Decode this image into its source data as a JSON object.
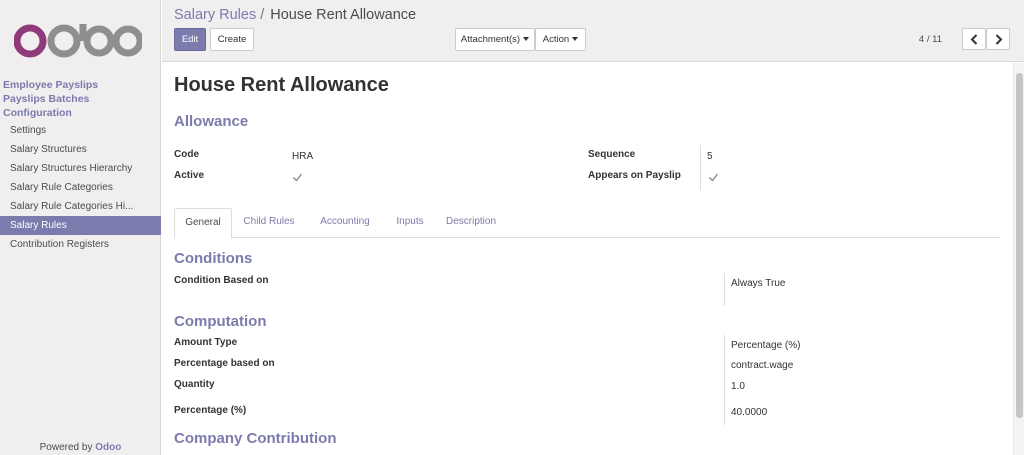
{
  "brand": {
    "logo_text": "odoo",
    "accent": "#7c7bad",
    "logo_color_o": "#8f3b7a",
    "logo_color_rest": "#8f8f8f"
  },
  "sidebar": {
    "headings": [
      "Employee Payslips",
      "Payslips Batches",
      "Configuration"
    ],
    "items": [
      {
        "label": "Settings",
        "active": false
      },
      {
        "label": "Salary Structures",
        "active": false
      },
      {
        "label": "Salary Structures Hierarchy",
        "active": false
      },
      {
        "label": "Salary Rule Categories",
        "active": false
      },
      {
        "label": "Salary Rule Categories Hi...",
        "active": false
      },
      {
        "label": "Salary Rules",
        "active": true
      },
      {
        "label": "Contribution Registers",
        "active": false
      }
    ],
    "powered_prefix": "Powered by",
    "powered_brand": "Odoo"
  },
  "breadcrumb": {
    "parent": "Salary Rules",
    "separator": "/",
    "current": "House Rent Allowance"
  },
  "toolbar": {
    "edit_label": "Edit",
    "create_label": "Create",
    "attachments_label": "Attachment(s)",
    "action_label": "Action",
    "pager": "4 / 11"
  },
  "form": {
    "title": "House Rent Allowance",
    "category": "Allowance",
    "fields": {
      "code_label": "Code",
      "code_value": "HRA",
      "sequence_label": "Sequence",
      "sequence_value": "5",
      "active_label": "Active",
      "active_checked": true,
      "payslip_label": "Appears on Payslip",
      "payslip_checked": true
    },
    "tabs": [
      {
        "label": "General",
        "active": true
      },
      {
        "label": "Child Rules",
        "active": false
      },
      {
        "label": "Accounting",
        "active": false
      },
      {
        "label": "Inputs",
        "active": false
      },
      {
        "label": "Description",
        "active": false
      }
    ],
    "conditions": {
      "heading": "Conditions",
      "based_on_label": "Condition Based on",
      "based_on_value": "Always True"
    },
    "computation": {
      "heading": "Computation",
      "amount_type_label": "Amount Type",
      "amount_type_value": "Percentage (%)",
      "pct_based_label": "Percentage based on",
      "pct_based_value": "contract.wage",
      "quantity_label": "Quantity",
      "quantity_value": "1.0",
      "pct_label": "Percentage (%)",
      "pct_value": "40.0000"
    },
    "company_contribution": {
      "heading": "Company Contribution"
    }
  }
}
